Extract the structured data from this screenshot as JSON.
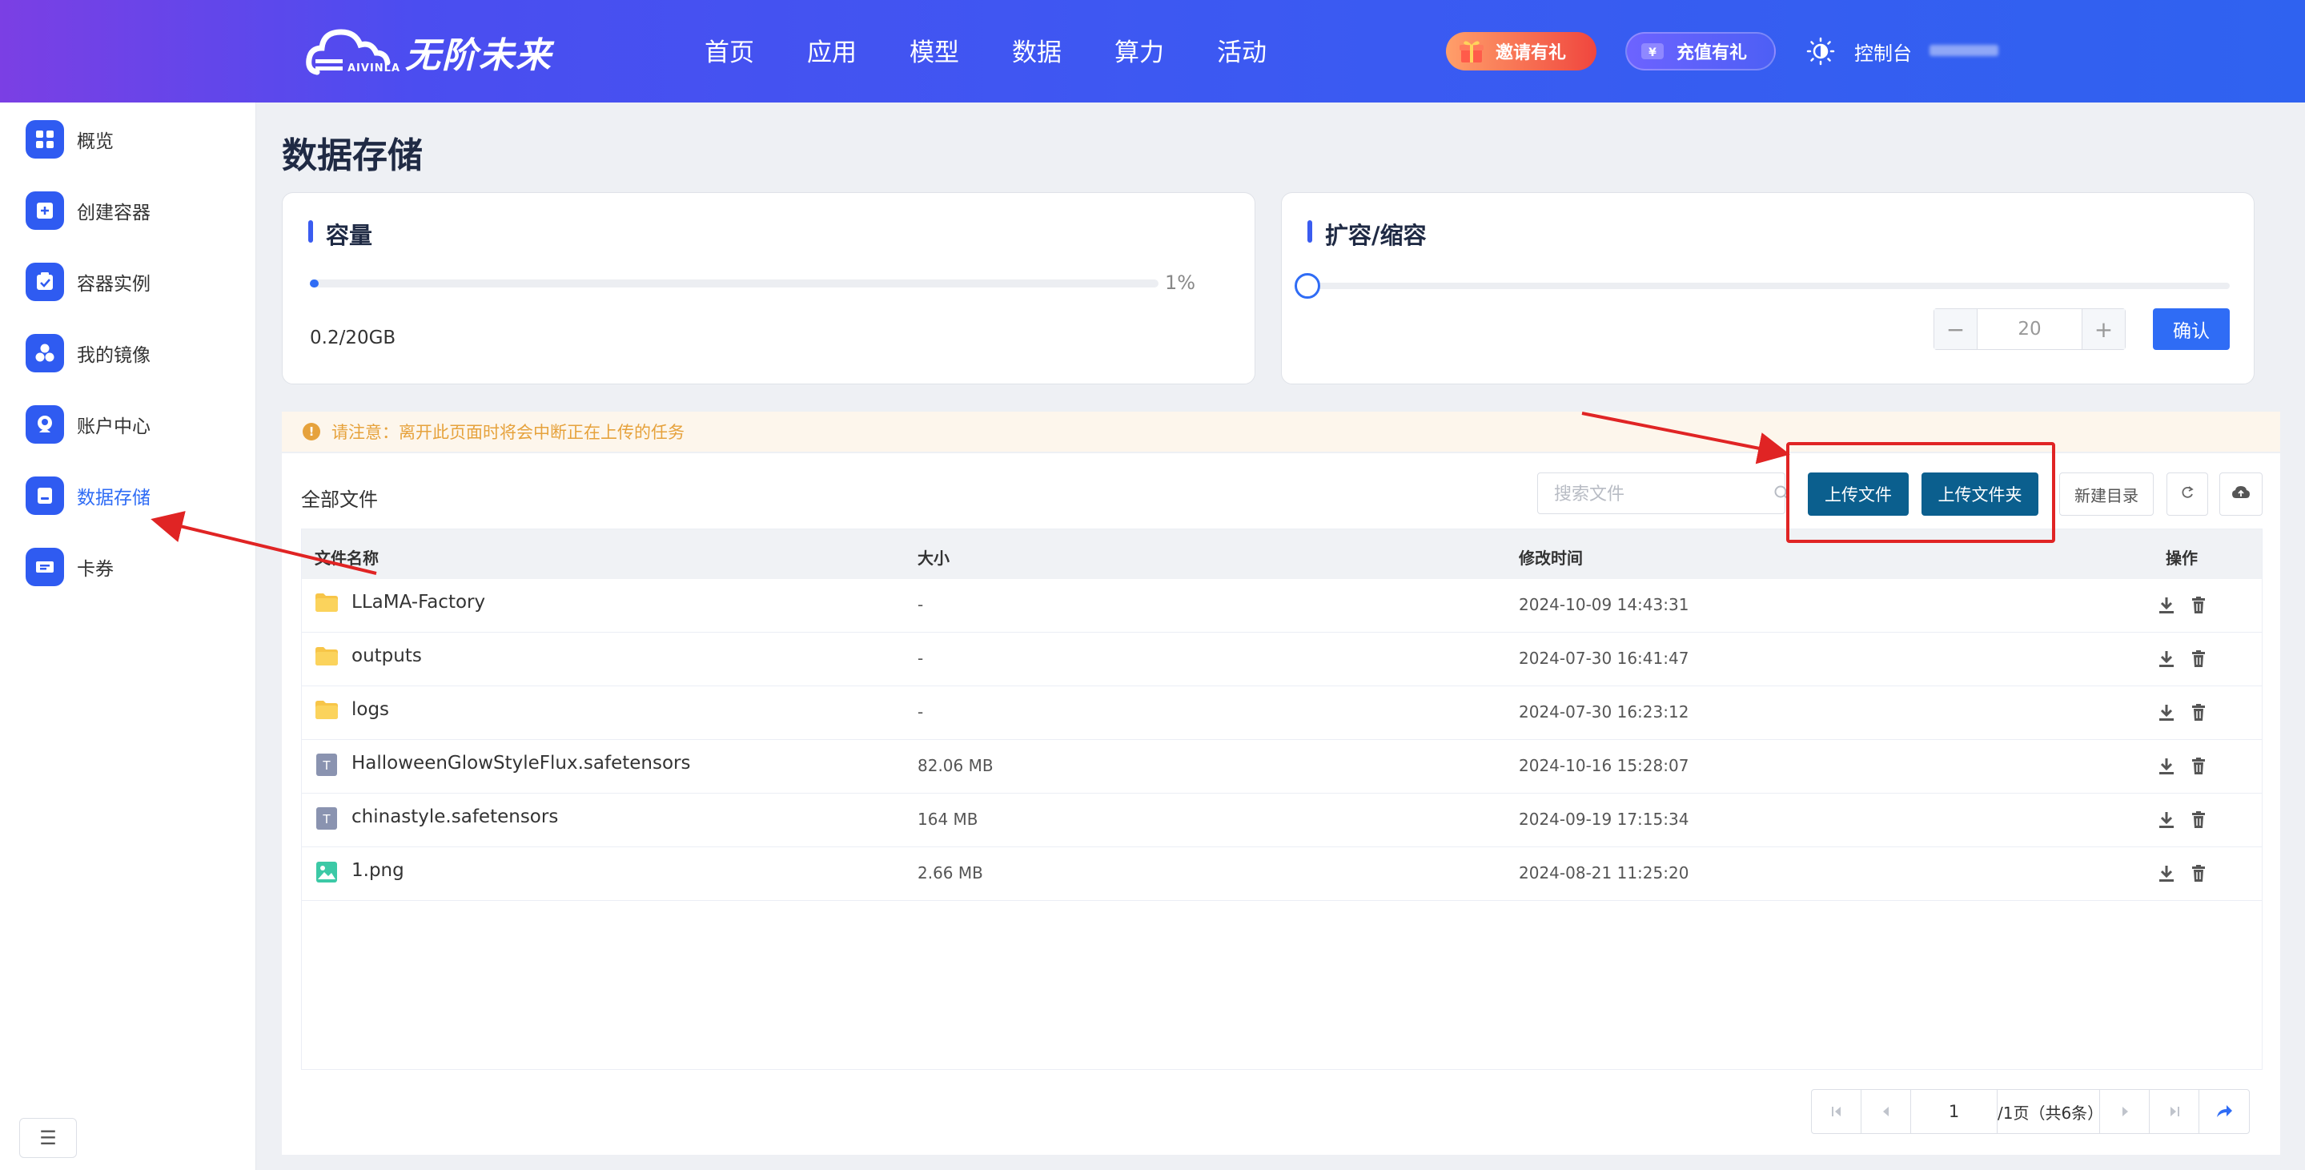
{
  "brand": {
    "name": "无阶未来",
    "sub": "AIVINLA"
  },
  "nav": [
    "首页",
    "应用",
    "模型",
    "数据",
    "算力",
    "活动"
  ],
  "header": {
    "invite_label": "邀请有礼",
    "recharge_label": "充值有礼",
    "console_label": "控制台"
  },
  "sidebar": {
    "items": [
      {
        "label": "概览",
        "icon": "grid-icon"
      },
      {
        "label": "创建容器",
        "icon": "plus-box-icon"
      },
      {
        "label": "容器实例",
        "icon": "check-box-icon"
      },
      {
        "label": "我的镜像",
        "icon": "hexagons-icon"
      },
      {
        "label": "账户中心",
        "icon": "user-icon"
      },
      {
        "label": "数据存储",
        "icon": "storage-icon",
        "active": true
      },
      {
        "label": "卡券",
        "icon": "ticket-icon"
      }
    ]
  },
  "page": {
    "title": "数据存储"
  },
  "capacity": {
    "title": "容量",
    "percent_label": "1%",
    "percent": 0.01,
    "usage": "0.2/20GB"
  },
  "expand": {
    "title": "扩容/缩容",
    "value": "20",
    "confirm": "确认",
    "slider_level": 0
  },
  "notice": "请注意：离开此页面时将会中断正在上传的任务",
  "files": {
    "title": "全部文件",
    "search_placeholder": "搜索文件",
    "upload_file": "上传文件",
    "upload_folder": "上传文件夹",
    "new_dir": "新建目录",
    "headers": {
      "name": "文件名称",
      "size": "大小",
      "modified": "修改时间",
      "actions": "操作"
    },
    "rows": [
      {
        "name": "LLaMA-Factory",
        "size": "-",
        "modified": "2024-10-09 14:43:31",
        "type": "folder"
      },
      {
        "name": "outputs",
        "size": "-",
        "modified": "2024-07-30 16:41:47",
        "type": "folder"
      },
      {
        "name": "logs",
        "size": "-",
        "modified": "2024-07-30 16:23:12",
        "type": "folder"
      },
      {
        "name": "HalloweenGlowStyleFlux.safetensors",
        "size": "82.06 MB",
        "modified": "2024-10-16 15:28:07",
        "type": "text"
      },
      {
        "name": "chinastyle.safetensors",
        "size": "164 MB",
        "modified": "2024-09-19 17:15:34",
        "type": "text"
      },
      {
        "name": "1.png",
        "size": "2.66 MB",
        "modified": "2024-08-21 11:25:20",
        "type": "image"
      }
    ]
  },
  "pagination": {
    "page": "1",
    "info": "/1页（共6条）"
  },
  "colors": {
    "primary": "#2f6cf5",
    "upload_btn": "#0b5f8e",
    "highlight": "#e02424",
    "warning": "#e6a23c"
  }
}
